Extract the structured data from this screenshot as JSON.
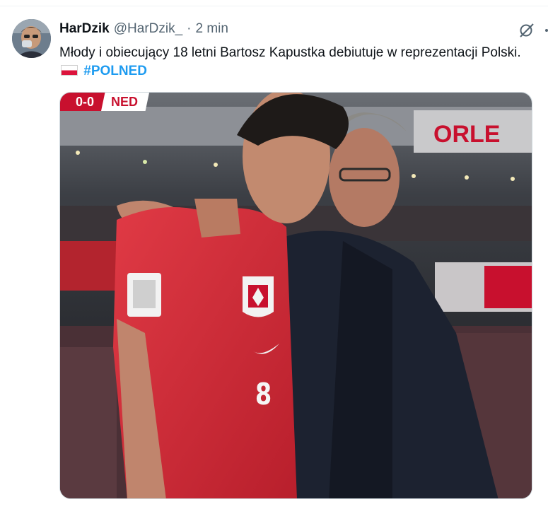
{
  "tweet": {
    "author": {
      "display_name": "HarDzik",
      "handle": "@HarDzik_"
    },
    "separator": "·",
    "time": "2 min",
    "text_main": "Młody i obiecujący 18 letni Bartosz Kapustka debiutuje w reprezentacji Polski.",
    "hashtag": "#POLNED",
    "icons": [
      "avatar",
      "grok-icon",
      "more-icon",
      "poland-flag-icon"
    ]
  },
  "media": {
    "scorebug": {
      "score": "0-0",
      "team": "NED"
    },
    "jersey_number": "8",
    "colors": {
      "jersey_red": "#d42a36",
      "coach_navy": "#1c2230",
      "score_red": "#c8102e",
      "hashtag_blue": "#1d9bf0"
    }
  }
}
